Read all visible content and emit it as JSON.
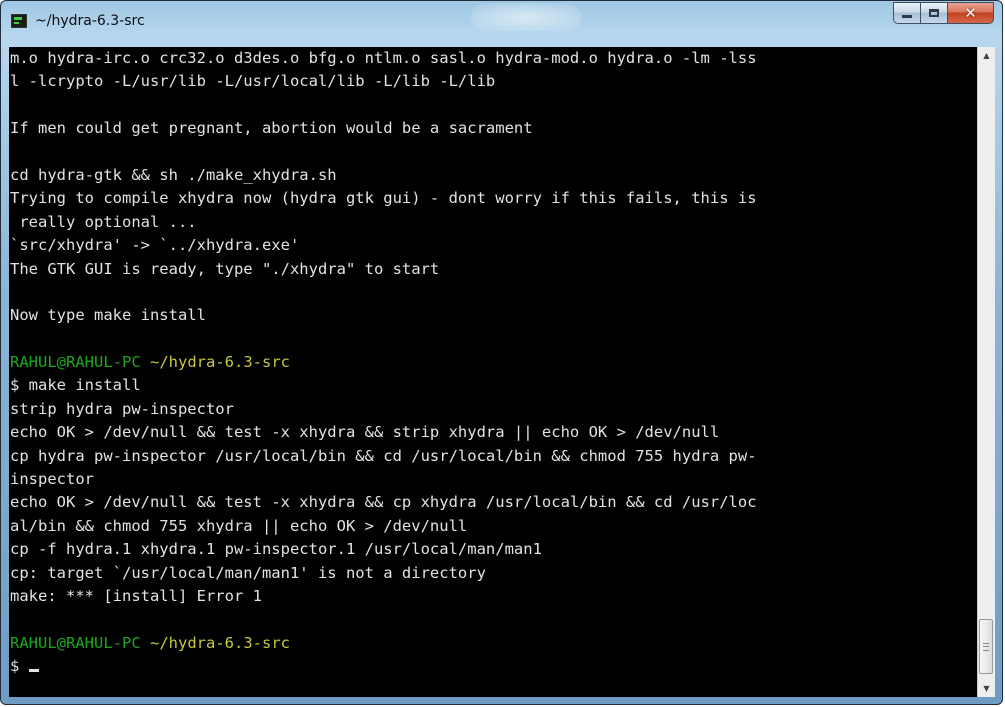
{
  "window": {
    "title": "~/hydra-6.3-src",
    "icon": "terminal-icon",
    "controls": {
      "minimize": "minimize-icon",
      "maximize": "maximize-icon",
      "close": "close-icon"
    }
  },
  "colors": {
    "background": "#000000",
    "text": "#e2e2e2",
    "prompt_user": "#19a819",
    "prompt_path": "#c8c83a"
  },
  "terminal": {
    "lines": [
      "m.o hydra-irc.o crc32.o d3des.o bfg.o ntlm.o sasl.o hydra-mod.o hydra.o -lm -lss",
      "l -lcrypto -L/usr/lib -L/usr/local/lib -L/lib -L/lib",
      "",
      "If men could get pregnant, abortion would be a sacrament",
      "",
      "cd hydra-gtk && sh ./make_xhydra.sh",
      "Trying to compile xhydra now (hydra gtk gui) - dont worry if this fails, this is",
      " really optional ...",
      "`src/xhydra' -> `../xhydra.exe'",
      "The GTK GUI is ready, type \"./xhydra\" to start",
      "",
      "Now type make install",
      "",
      {
        "user": "RAHUL@RAHUL-PC",
        "path": "~/hydra-6.3-src"
      },
      "$ make install",
      "strip hydra pw-inspector",
      "echo OK > /dev/null && test -x xhydra && strip xhydra || echo OK > /dev/null",
      "cp hydra pw-inspector /usr/local/bin && cd /usr/local/bin && chmod 755 hydra pw-",
      "inspector",
      "echo OK > /dev/null && test -x xhydra && cp xhydra /usr/local/bin && cd /usr/loc",
      "al/bin && chmod 755 xhydra || echo OK > /dev/null",
      "cp -f hydra.1 xhydra.1 pw-inspector.1 /usr/local/man/man1",
      "cp: target `/usr/local/man/man1' is not a directory",
      "make: *** [install] Error 1",
      "",
      {
        "user": "RAHUL@RAHUL-PC",
        "path": "~/hydra-6.3-src"
      }
    ],
    "input_prompt": "$ ",
    "input_value": ""
  }
}
